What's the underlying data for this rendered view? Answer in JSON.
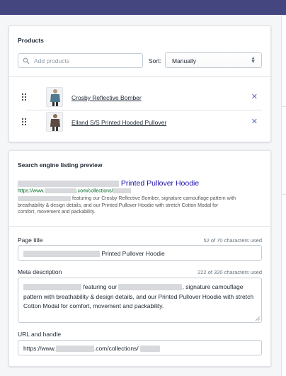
{
  "colors": {
    "topbar": "#43467f",
    "accent": "#5c6ac4",
    "seo_link": "#1a0dab",
    "seo_url": "#006621"
  },
  "products_card": {
    "title": "Products",
    "search": {
      "placeholder": "Add products",
      "icon": "search-icon"
    },
    "sort": {
      "label": "Sort:",
      "value": "Manually"
    },
    "items": [
      {
        "name": "Crosby Reflective Bomber",
        "remove_icon": "close-icon"
      },
      {
        "name": "Elland S/S Printed Hooded Pullover",
        "remove_icon": "close-icon"
      }
    ]
  },
  "seo_card": {
    "title": "Search engine listing preview",
    "preview": {
      "title_visible": "Printed Pullover Hoodie",
      "url_prefix": "https://www.",
      "url_middle": ".com/collections/",
      "desc_line1": "featuring our Crosby Reflective Bomber, signature camouflage pattern with",
      "desc_line2": "breathability & design details, and our Printed Pullover Hoodie with stretch Cotton Modal for",
      "desc_line3": "comfort, movement and packability."
    },
    "page_title": {
      "label": "Page title",
      "count": "52 of 70 characters used",
      "value_visible": "Printed Pullover Hoodie"
    },
    "meta_description": {
      "label": "Meta description",
      "count": "222 of 320 characters used",
      "part1": "featuring our",
      "part2": ", signature camouflage",
      "line2": "pattern with breathability & design details, and our Printed Pullover Hoodie with stretch",
      "line3": "Cotton Modal for comfort, movement and packability."
    },
    "url_handle": {
      "label": "URL and handle",
      "prefix": "https://www.",
      "middle": ".com/collections/"
    }
  }
}
